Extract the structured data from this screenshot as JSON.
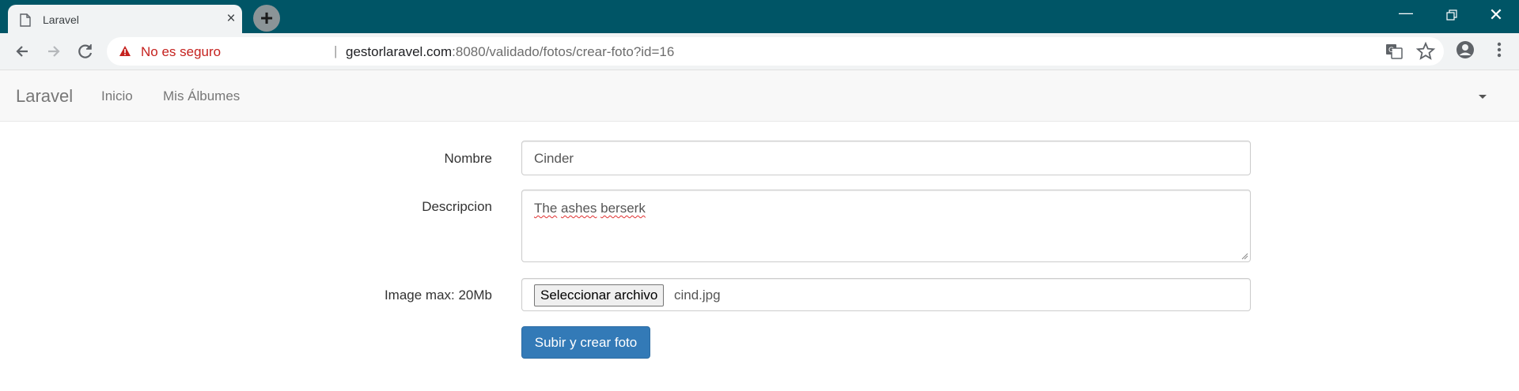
{
  "browser": {
    "tab_title": "Laravel",
    "tab_close": "×",
    "new_tab": "+",
    "security_label": "No es seguro",
    "url_separator": "|",
    "url_host": "gestorlaravel.com",
    "url_rest": ":8080/validado/fotos/crear-foto?id=16",
    "window_controls": {
      "minimize": "—",
      "close": "✕"
    },
    "icons": [
      "page-icon",
      "back-arrow-icon",
      "forward-arrow-icon",
      "reload-icon",
      "warning-icon",
      "translate-icon",
      "star-icon",
      "profile-icon",
      "menu-dots-icon"
    ],
    "colors": {
      "titlebar": "#005566",
      "not_secure": "#c5221f"
    }
  },
  "navbar": {
    "brand": "Laravel",
    "links": [
      "Inicio",
      "Mis Álbumes"
    ],
    "dropdown_icon": "caret-down-icon"
  },
  "form": {
    "name_label": "Nombre",
    "name_value": "Cinder",
    "description_label": "Descripcion",
    "description_words": [
      "The",
      "ashes",
      "berserk"
    ],
    "image_label": "Image max: 20Mb",
    "file_button": "Seleccionar archivo",
    "file_name": "cind.jpg",
    "submit": "Subir y crear foto",
    "colors": {
      "submit": "#337ab7"
    }
  }
}
